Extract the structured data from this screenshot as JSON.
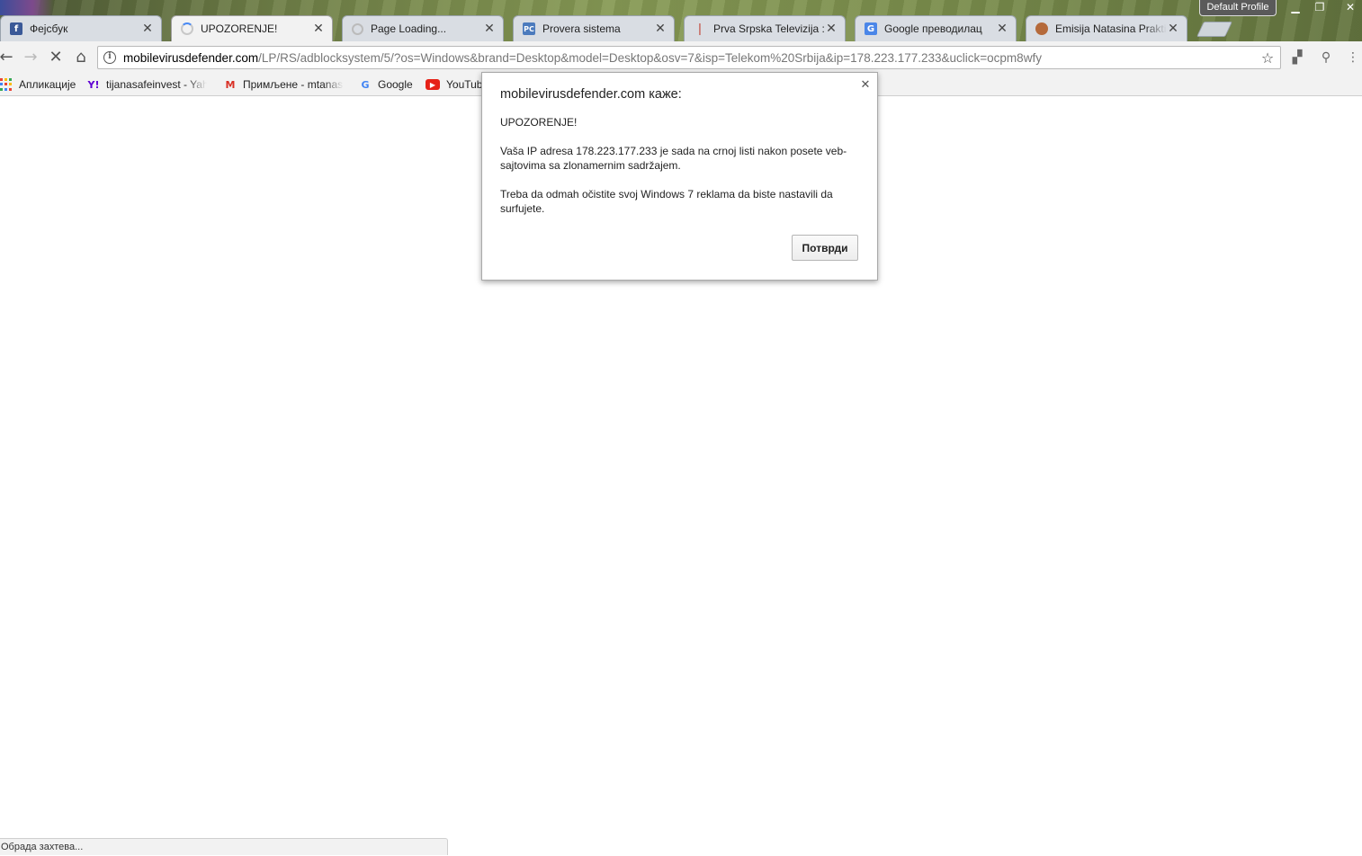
{
  "window": {
    "profile_label": "Default Profile",
    "controls": {
      "minimize": "▁",
      "maximize": "❐",
      "close": "✕"
    }
  },
  "tabs": [
    {
      "title": "Фејсбук",
      "favicon": "facebook-icon",
      "favicon_glyph": "f",
      "active": false
    },
    {
      "title": "UPOZORENJE!",
      "favicon": "loading-spinner-icon",
      "favicon_glyph": "",
      "active": true
    },
    {
      "title": "Page Loading...",
      "favicon": "loading-circle-icon",
      "favicon_glyph": "",
      "active": false
    },
    {
      "title": "Provera sistema",
      "favicon": "pc-icon",
      "favicon_glyph": "PC",
      "active": false
    },
    {
      "title": "Prva Srpska Televizija :: L",
      "favicon": "rts-icon",
      "favicon_glyph": "❘",
      "active": false
    },
    {
      "title": "Google преводилац",
      "favicon": "google-translate-icon",
      "favicon_glyph": "G",
      "active": false
    },
    {
      "title": "Emisija Natasina Praktic",
      "favicon": "emisija-icon",
      "favicon_glyph": "",
      "active": false
    }
  ],
  "tab_close_glyph": "✕",
  "toolbar": {
    "back_glyph": "←",
    "forward_glyph": "→",
    "stop_glyph": "✕",
    "home_glyph": "⌂",
    "info_glyph": "i",
    "url_host": "mobilevirusdefender.com",
    "url_path": "/LP/RS/adblocksystem/5/?os=Windows&brand=Desktop&model=Desktop&osv=7&isp=Telekom%20Srbija&ip=178.223.177.233&uclick=ocpm8wfy",
    "star_glyph": "☆",
    "extension_glyph_1": "▞",
    "extension_glyph_2": "⚲",
    "menu_glyph": "⋮"
  },
  "bookmarks": [
    {
      "label": "Апликације",
      "icon": "apps-grid-icon"
    },
    {
      "label": "tijanasafeinvest - Yah",
      "icon": "yahoo-icon",
      "glyph": "Y!"
    },
    {
      "label": "Примљене - mtanas",
      "icon": "gmail-icon",
      "glyph": "M"
    },
    {
      "label": "Google",
      "icon": "google-icon",
      "glyph": "G"
    },
    {
      "label": "YouTub",
      "icon": "youtube-icon",
      "glyph": "▶"
    }
  ],
  "dialog": {
    "title": "mobilevirusdefender.com каже:",
    "close_glyph": "✕",
    "line1": "UPOZORENJE!",
    "line2": "Vaša IP adresa 178.223.177.233 je sada na crnoj listi nakon posete veb-sajtovima sa zlonamernim sadržajem.",
    "line3": "Treba da odmah očistite svoj Windows 7 reklama da biste nastavili da surfujete.",
    "ok_label": "Потврди"
  },
  "status_text": "Обрада захтева...",
  "colors": {
    "gmail": "#d93025",
    "yahoo": "#6001d2",
    "youtube": "#e62117",
    "google_blue": "#4285f4"
  }
}
